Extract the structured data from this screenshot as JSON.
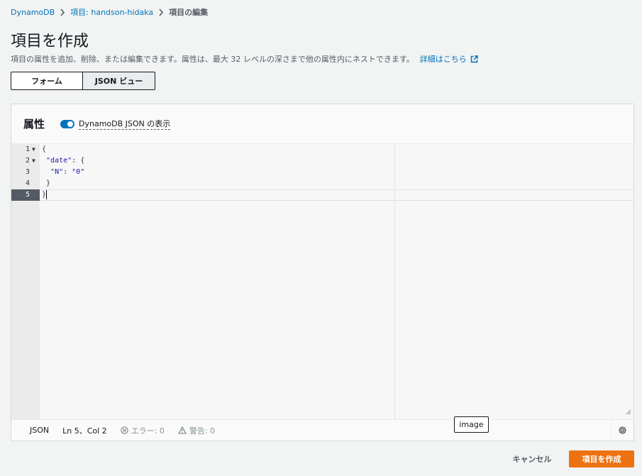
{
  "breadcrumb": {
    "items": [
      "DynamoDB",
      "項目: handson-hidaka"
    ],
    "current": "項目の編集"
  },
  "page": {
    "title": "項目を作成",
    "description": "項目の属性を追加、削除、または編集できます。属性は、最大 32 レベルの深さまで他の属性内にネストできます。",
    "learn_more": "詳細はこちら"
  },
  "view_toggle": {
    "options": [
      "フォーム",
      "JSON ビュー"
    ],
    "selected": "JSON ビュー"
  },
  "attributes_panel": {
    "title": "属性",
    "toggle_label": "DynamoDB JSON の表示",
    "toggle_on": true
  },
  "editor": {
    "lines": [
      {
        "num": "1",
        "fold": "▼",
        "text": "{"
      },
      {
        "num": "2",
        "fold": "▼",
        "text": " \"date\": {"
      },
      {
        "num": "3",
        "fold": "",
        "text": "  \"N\": \"0\""
      },
      {
        "num": "4",
        "fold": "",
        "text": " }"
      },
      {
        "num": "5",
        "fold": "",
        "text": "}"
      }
    ],
    "active_line": 5
  },
  "status_bar": {
    "mode": "JSON",
    "position": "Ln 5、Col 2",
    "errors": "エラー: 0",
    "warnings": "警告: 0"
  },
  "tooltip": {
    "text": "image"
  },
  "actions": {
    "cancel": "キャンセル",
    "create": "項目を作成"
  },
  "colors": {
    "link": "#0073bb",
    "primary": "#ec7211",
    "toggle": "#0073bb"
  }
}
